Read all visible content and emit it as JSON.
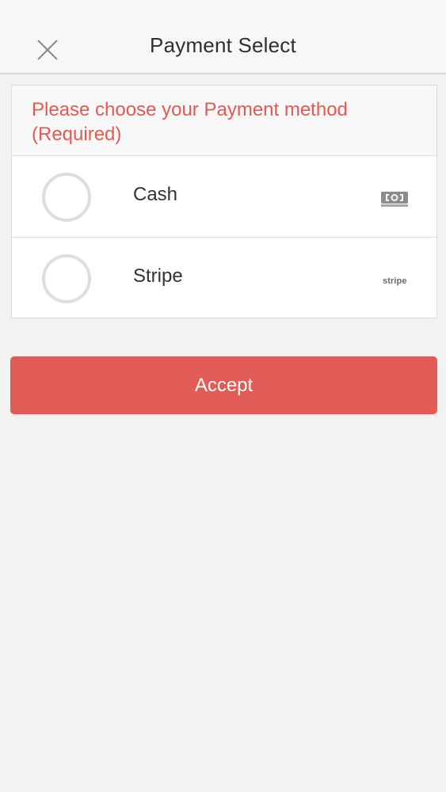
{
  "header": {
    "title": "Payment Select",
    "close_icon": "close-icon"
  },
  "payment": {
    "prompt": "Please choose your Payment method (Required)",
    "options": [
      {
        "label": "Cash",
        "icon": "cash-icon",
        "selected": false
      },
      {
        "label": "Stripe",
        "icon": "stripe-logo",
        "logo_text": "stripe",
        "selected": false
      }
    ]
  },
  "actions": {
    "accept_label": "Accept"
  },
  "colors": {
    "accent": "#e15c56",
    "prompt_text": "#e15b53",
    "background": "#f2f2f2"
  }
}
